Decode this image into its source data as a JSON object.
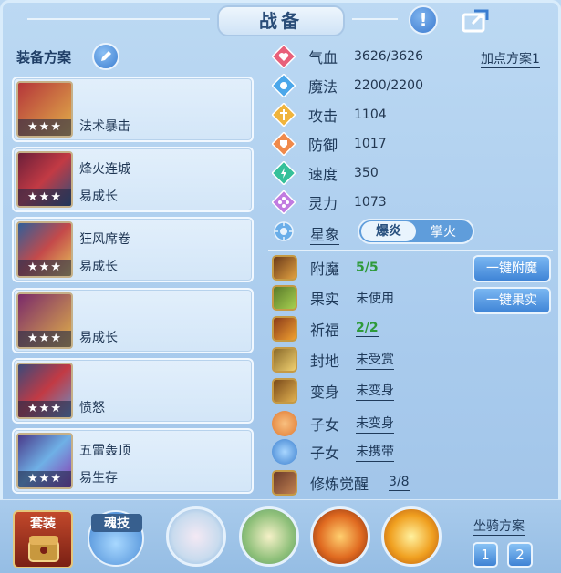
{
  "header": {
    "title": "战备"
  },
  "left": {
    "plan_label": "装备方案",
    "items": [
      {
        "name": "",
        "sub": "法术暴击",
        "stars": "★★★"
      },
      {
        "name": "烽火连城",
        "sub": "易成长",
        "stars": "★★★"
      },
      {
        "name": "狂风席卷",
        "sub": "易成长",
        "stars": "★★★"
      },
      {
        "name": "",
        "sub": "易成长",
        "stars": "★★★"
      },
      {
        "name": "",
        "sub": "愤怒",
        "stars": "★★★"
      },
      {
        "name": "五雷轰顶",
        "sub": "易生存",
        "stars": "★★★"
      }
    ]
  },
  "stats": {
    "add_plan": "加点方案1",
    "rows": [
      {
        "label": "气血",
        "value": "3626/3626",
        "icon": "heart-icon",
        "color": "#e8607a"
      },
      {
        "label": "魔法",
        "value": "2200/2200",
        "icon": "mana-icon",
        "color": "#4ba7ea"
      },
      {
        "label": "攻击",
        "value": "1104",
        "icon": "attack-icon",
        "color": "#f0b43c"
      },
      {
        "label": "防御",
        "value": "1017",
        "icon": "defense-icon",
        "color": "#f08a4b"
      },
      {
        "label": "速度",
        "value": "350",
        "icon": "speed-icon",
        "color": "#35c09a"
      },
      {
        "label": "灵力",
        "value": "1073",
        "icon": "spirit-icon",
        "color": "#c17be0"
      }
    ],
    "star_label": "星象",
    "toggle": {
      "on": "爆炎",
      "off": "掌火"
    }
  },
  "extras": {
    "rows": [
      {
        "label": "附魔",
        "value": "5/5",
        "style": "green"
      },
      {
        "label": "果实",
        "value": "未使用",
        "style": "plain"
      },
      {
        "label": "祈福",
        "value": "2/2",
        "style": "green-u"
      },
      {
        "label": "封地",
        "value": "未受赏",
        "style": "u"
      },
      {
        "label": "变身",
        "value": "未变身",
        "style": "u"
      },
      {
        "label": "子女",
        "value": "未变身",
        "style": "u"
      },
      {
        "label": "子女",
        "value": "未携带",
        "style": "u"
      },
      {
        "label": "修炼觉醒",
        "value": "3/8",
        "style": "u"
      }
    ],
    "btn_enchant": "一键附魔",
    "btn_fruit": "一键果实"
  },
  "bottom": {
    "suit_tab": "套装",
    "soul_tab": "魂技",
    "mount_label": "坐骑方案",
    "mount_1": "1",
    "mount_2": "2"
  }
}
